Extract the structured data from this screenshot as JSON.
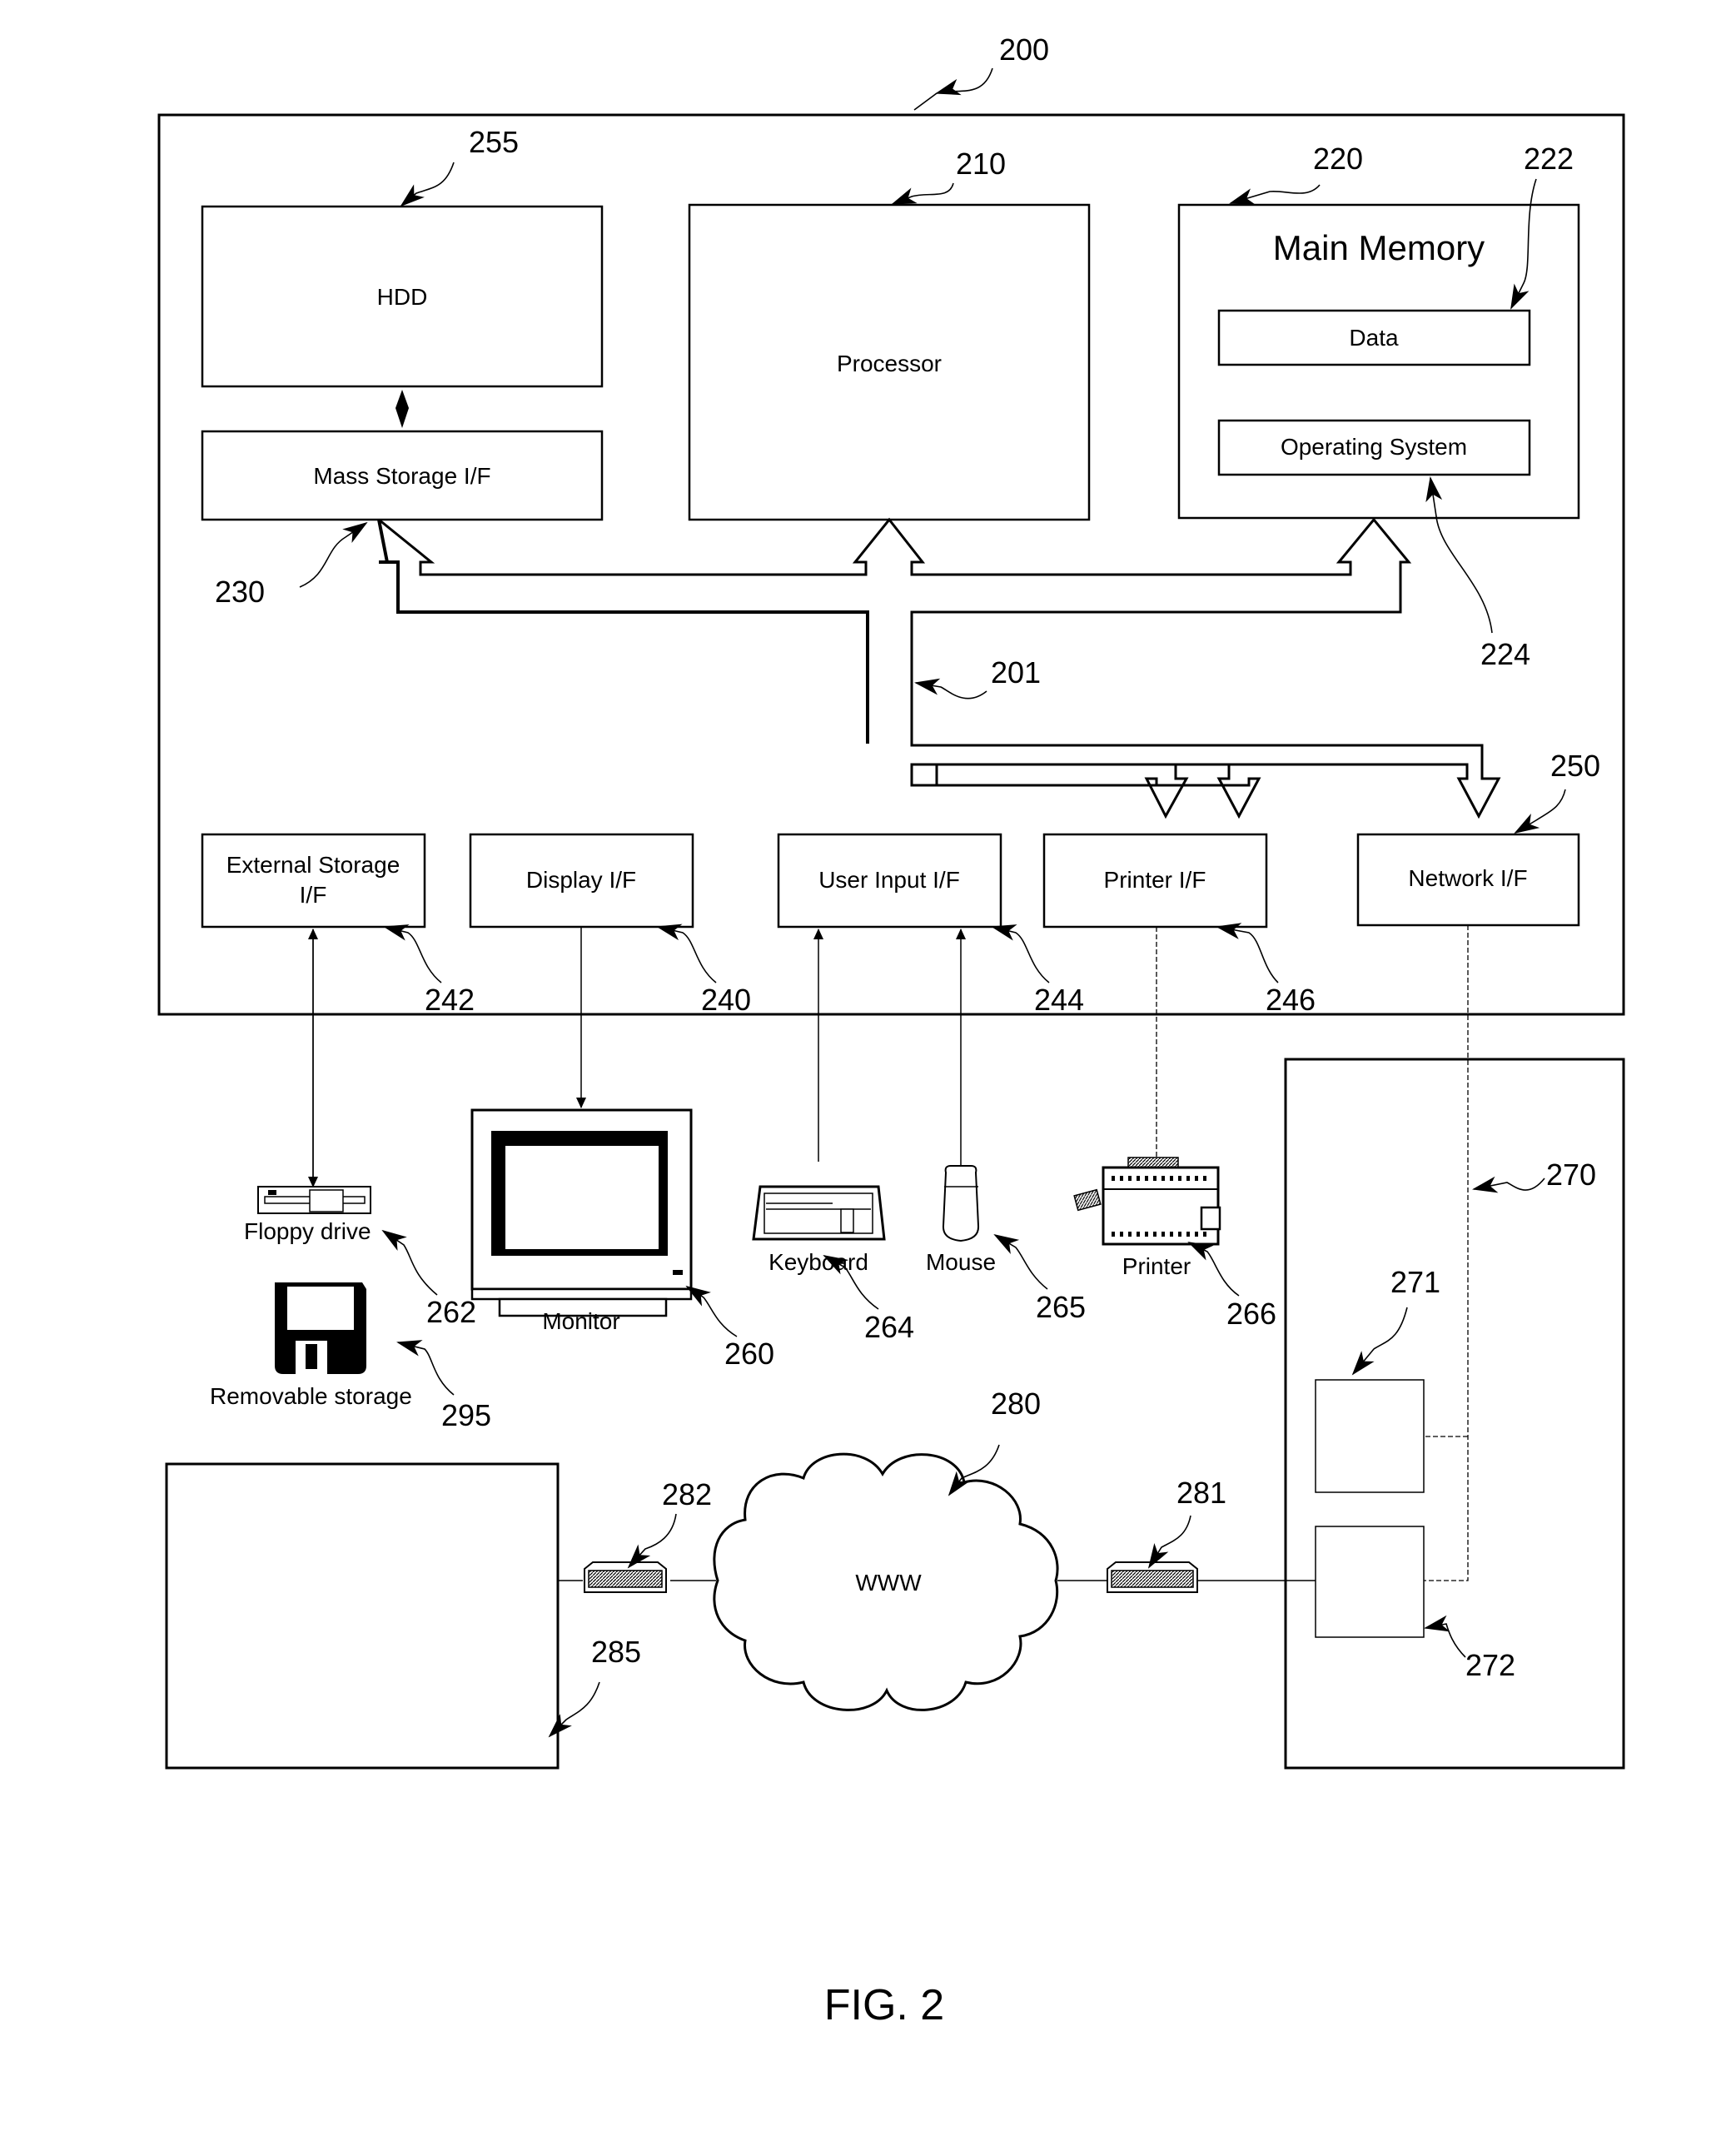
{
  "figure": {
    "caption": "FIG. 2"
  },
  "system": {
    "ref": "200",
    "bus_ref": "201"
  },
  "components": {
    "hdd": {
      "label": "HDD",
      "ref": "255"
    },
    "mass_storage": {
      "label": "Mass Storage I/F",
      "ref": "230"
    },
    "processor": {
      "label": "Processor",
      "ref": "210"
    },
    "main_memory": {
      "label": "Main Memory",
      "ref": "220"
    },
    "data": {
      "label": "Data",
      "ref": "222"
    },
    "os": {
      "label": "Operating System",
      "ref": "224"
    }
  },
  "interfaces": [
    {
      "label_line1": "External Storage",
      "label_line2": "I/F",
      "ref": "242"
    },
    {
      "label_line1": "Display I/F",
      "label_line2": "",
      "ref": "240"
    },
    {
      "label_line1": "User Input I/F",
      "label_line2": "",
      "ref": "244"
    },
    {
      "label_line1": "Printer I/F",
      "label_line2": "",
      "ref": "246"
    },
    {
      "label_line1": "Network I/F",
      "label_line2": "",
      "ref": "250"
    }
  ],
  "peripherals": {
    "floppy": {
      "label": "Floppy drive",
      "ref": "262"
    },
    "removable": {
      "label": "Removable storage",
      "ref": "295"
    },
    "monitor": {
      "label": "Monitor",
      "ref": "260"
    },
    "keyboard": {
      "label": "Keyboard",
      "ref": "264"
    },
    "mouse": {
      "label": "Mouse",
      "ref": "265"
    },
    "printer": {
      "label": "Printer",
      "ref": "266"
    }
  },
  "network": {
    "cloud": {
      "label": "WWW",
      "ref": "280"
    },
    "modem_left": {
      "ref": "282"
    },
    "modem_right": {
      "ref": "281"
    },
    "remote_computer": {
      "ref": "285"
    },
    "server": {
      "ref": "270",
      "module_a_ref": "271",
      "module_b_ref": "272"
    }
  }
}
